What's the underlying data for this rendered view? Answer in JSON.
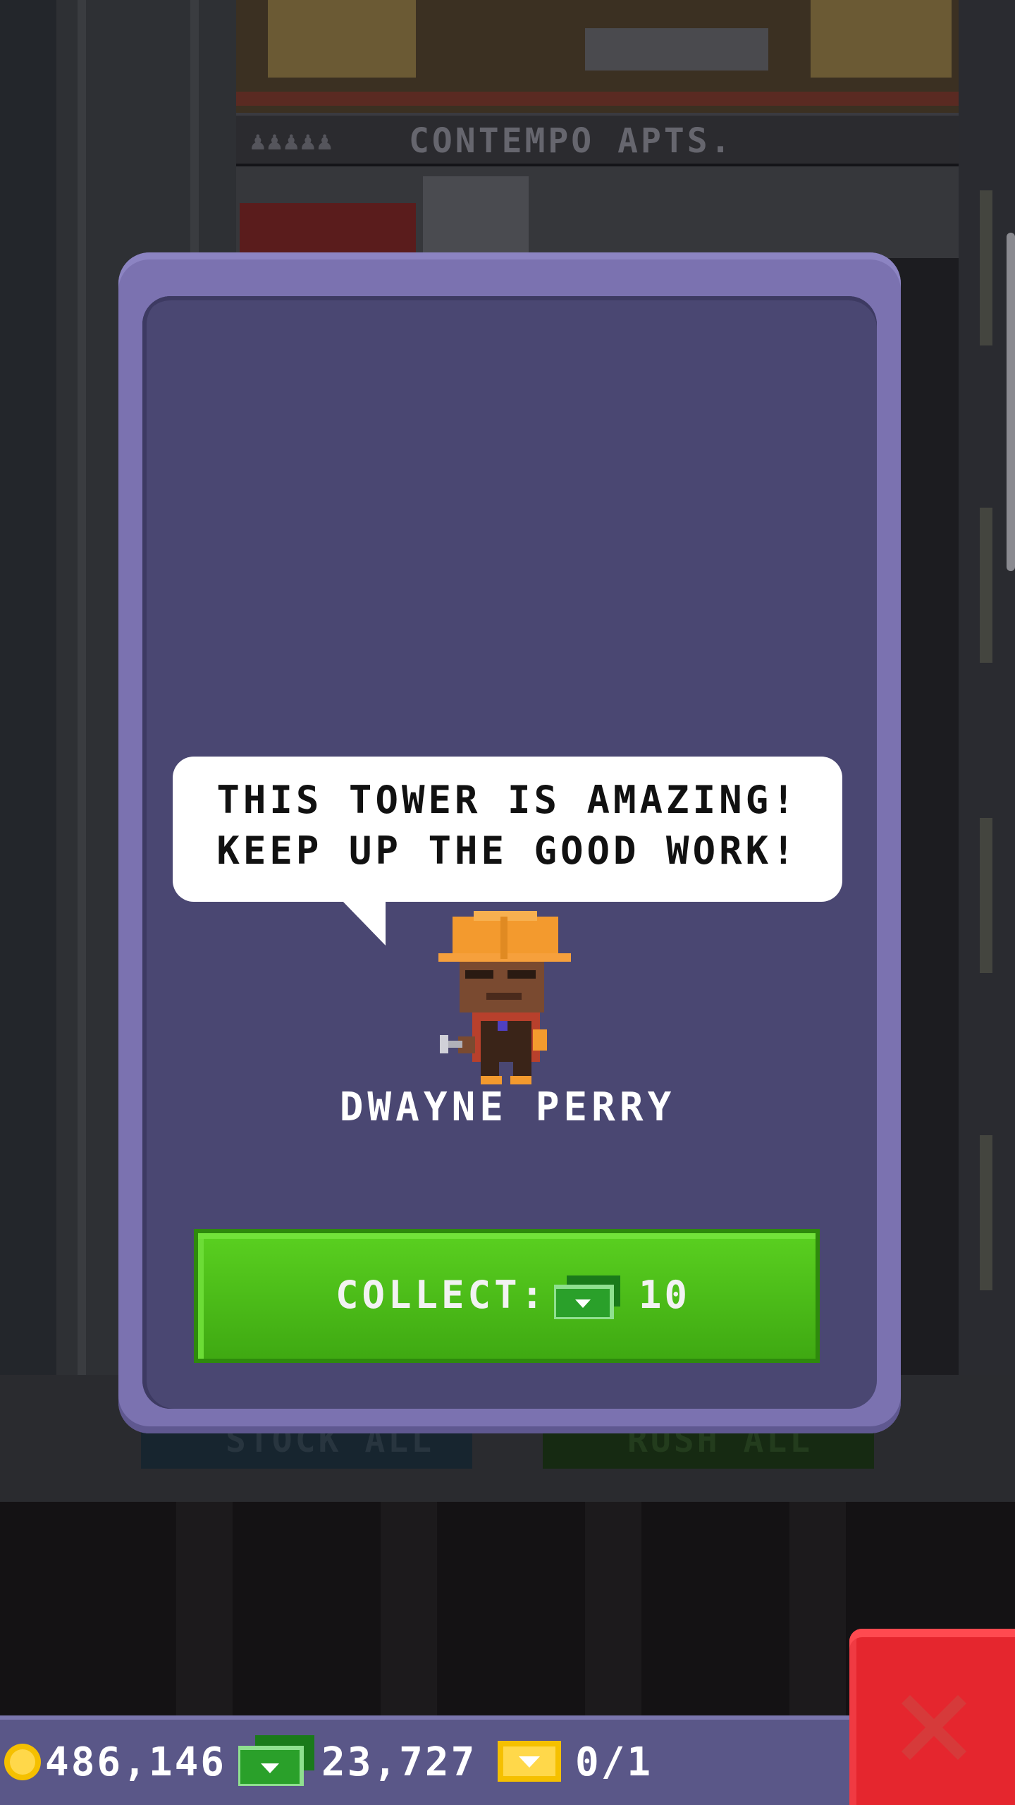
{
  "background": {
    "floor_number": "5",
    "floor_name": "CONTEMPO APTS.",
    "stock_all_label": "STOCK ALL",
    "rush_all_label": "RUSH ALL"
  },
  "dialog": {
    "speech_line_1": "THIS TOWER IS AMAZING!",
    "speech_line_2": "KEEP UP THE GOOD WORK!",
    "character_name": "DWAYNE PERRY",
    "collect_label": "COLLECT:",
    "collect_amount": "10",
    "collect_currency_icon": "tower-bux-icon"
  },
  "status_bar": {
    "coins": "486,146",
    "bux": "23,727",
    "tickets": "0/1",
    "coin_icon": "coin-icon",
    "bux_icon": "tower-bux-icon",
    "ticket_icon": "golden-ticket-icon"
  },
  "close_icon": "close-icon",
  "colors": {
    "modal_frame": "#7b72b0",
    "modal_fill": "#4a4772",
    "collect_green": "#4cbd18",
    "close_red": "#e5262e",
    "status_bar": "#5a5788"
  }
}
